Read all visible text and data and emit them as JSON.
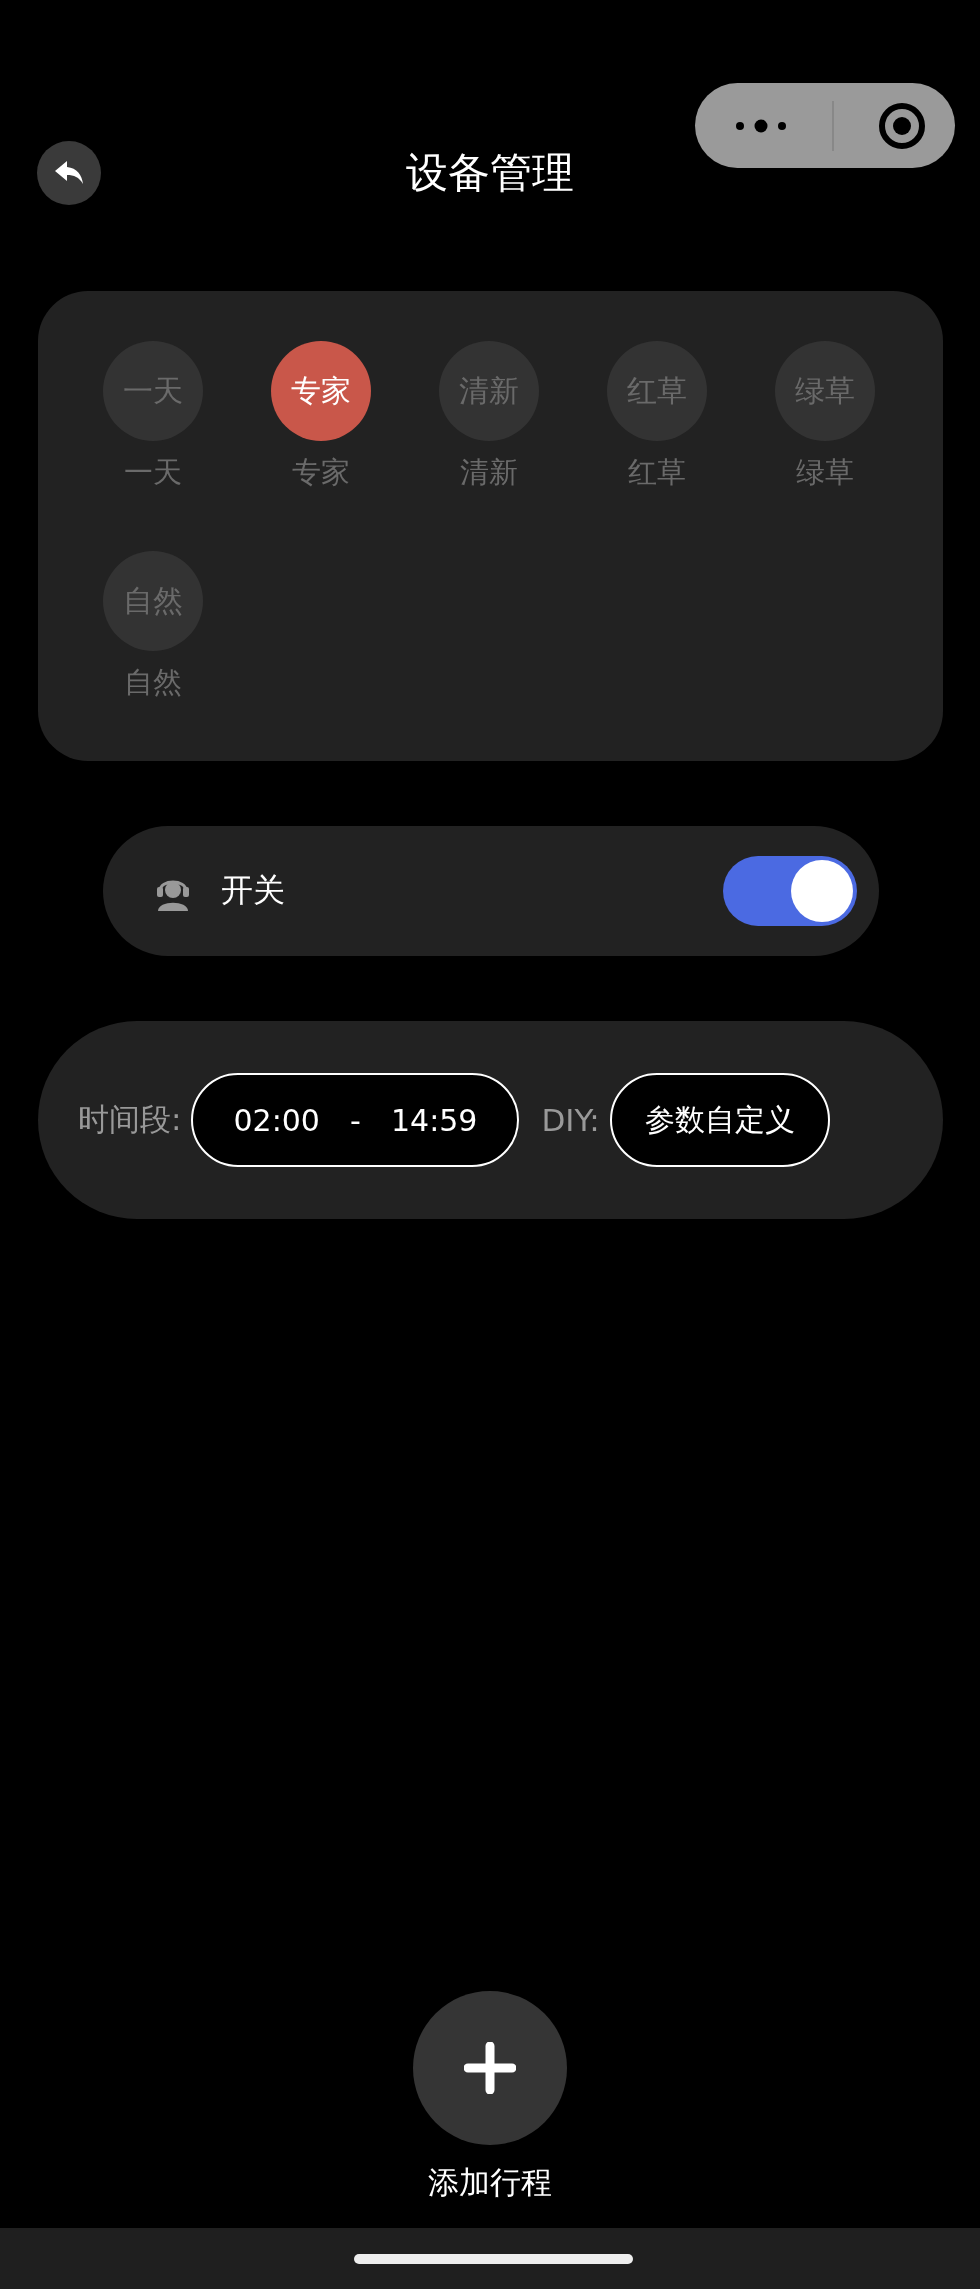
{
  "title": "设备管理",
  "modes": [
    {
      "badge": "一天",
      "label": "一天",
      "selected": false
    },
    {
      "badge": "专家",
      "label": "专家",
      "selected": true
    },
    {
      "badge": "清新",
      "label": "清新",
      "selected": false
    },
    {
      "badge": "红草",
      "label": "红草",
      "selected": false
    },
    {
      "badge": "绿草",
      "label": "绿草",
      "selected": false
    },
    {
      "badge": "自然",
      "label": "自然",
      "selected": false
    }
  ],
  "power": {
    "label": "开关",
    "on": true
  },
  "schedule": {
    "label": "时间段:",
    "start": "02:00",
    "separator": "-",
    "end": "14:59",
    "diy_label": "DIY:",
    "diy_button": "参数自定义"
  },
  "add": {
    "label": "添加行程"
  }
}
